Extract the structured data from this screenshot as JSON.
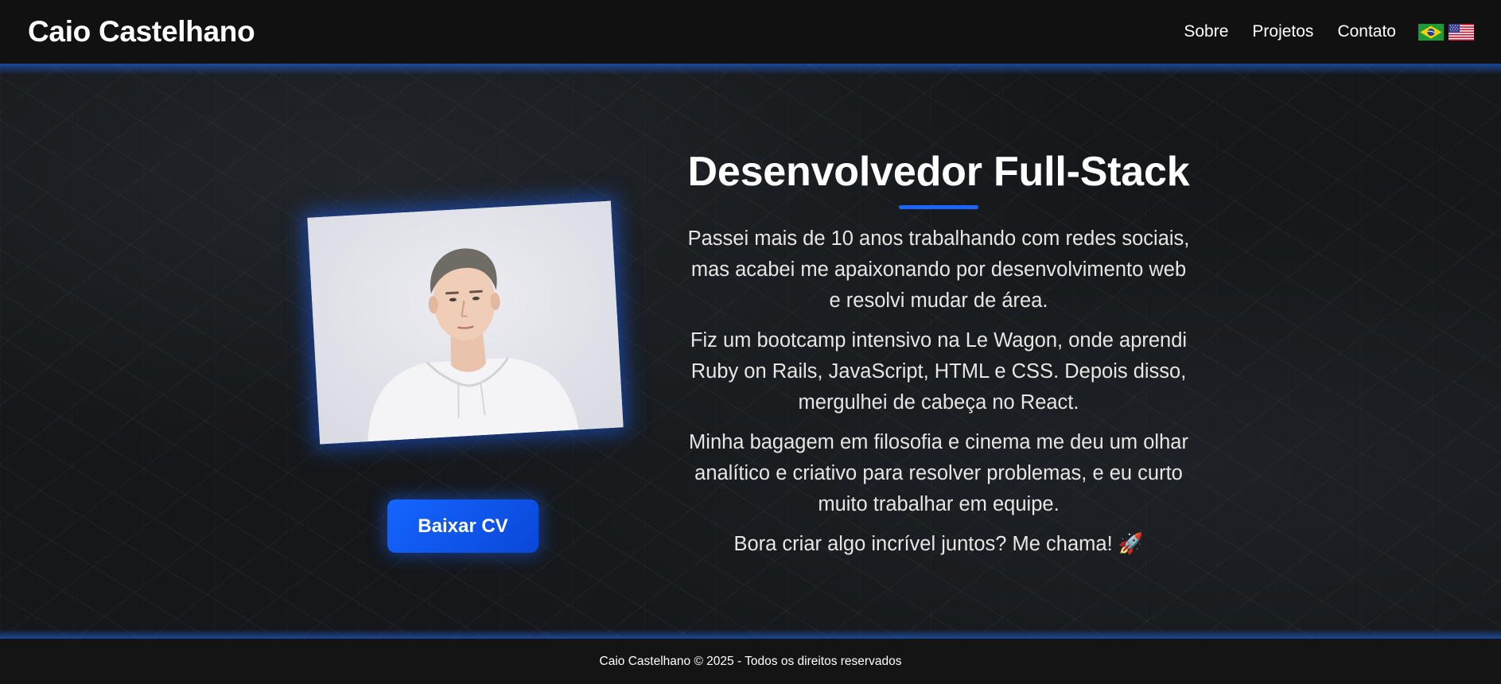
{
  "navbar": {
    "brand": "Caio Castelhano",
    "links": [
      "Sobre",
      "Projetos",
      "Contato"
    ],
    "flags": [
      "brazil-flag-icon",
      "usa-flag-icon"
    ]
  },
  "hero": {
    "photo": "profile-photo",
    "cv_button": "Baixar CV",
    "title": "Desenvolvedor Full-Stack",
    "paragraphs": [
      "Passei mais de 10 anos trabalhando com redes sociais, mas acabei me apaixonando por desenvolvimento web e resolvi mudar de área.",
      "Fiz um bootcamp intensivo na Le Wagon, onde aprendi Ruby on Rails, JavaScript, HTML e CSS. Depois disso, mergulhei de cabeça no React.",
      "Minha bagagem em filosofia e cinema me deu um olhar analítico e criativo para resolver problemas, e eu curto muito trabalhar em equipe.",
      "Bora criar algo incrível juntos? Me chama! 🚀"
    ]
  },
  "footer": {
    "text": "Caio Castelhano © 2025 - Todos os direitos reservados"
  },
  "colors": {
    "accent": "#1a66ff",
    "background": "#15171a",
    "navbar": "#111111"
  }
}
